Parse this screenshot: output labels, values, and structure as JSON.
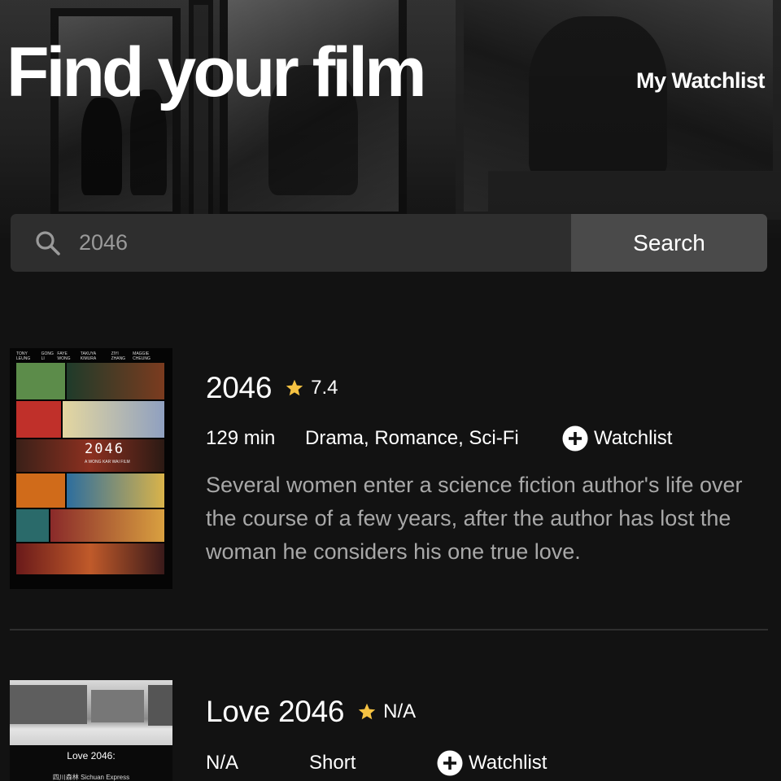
{
  "header": {
    "title": "Find your film",
    "watchlist_link": "My Watchlist"
  },
  "search": {
    "icon": "search-icon",
    "value": "2046",
    "button_label": "Search"
  },
  "results": [
    {
      "title": "2046",
      "rating": "7.4",
      "runtime": "129 min",
      "genres": "Drama, Romance, Sci-Fi",
      "watchlist_label": "Watchlist",
      "plot": "Several women enter a science fiction author's life over the course of a few years, after the author has lost the woman he considers his one true love.",
      "poster": {
        "credits": [
          "TONY LEUNG",
          "GONG LI",
          "FAYE WONG",
          "TAKUYA KIMURA",
          "ZIYI ZHANG",
          "MAGGIE CHEUNG"
        ],
        "title": "2046",
        "subtitle": "A WONG KAR WAI FILM"
      }
    },
    {
      "title": "Love 2046",
      "rating": "N/A",
      "runtime": "N/A",
      "genres": "Short",
      "watchlist_label": "Watchlist",
      "poster": {
        "title": "Love 2046:",
        "subtitle": "四川森林 Sichuan Express"
      }
    }
  ],
  "colors": {
    "background": "#121212",
    "star": "#f5c242",
    "search_field": "#2e2e2e",
    "search_button": "#4a4a4a",
    "muted_text": "#a8a8a8"
  },
  "icons": {
    "rating": "star-icon",
    "add_watchlist": "plus-circle-icon"
  }
}
